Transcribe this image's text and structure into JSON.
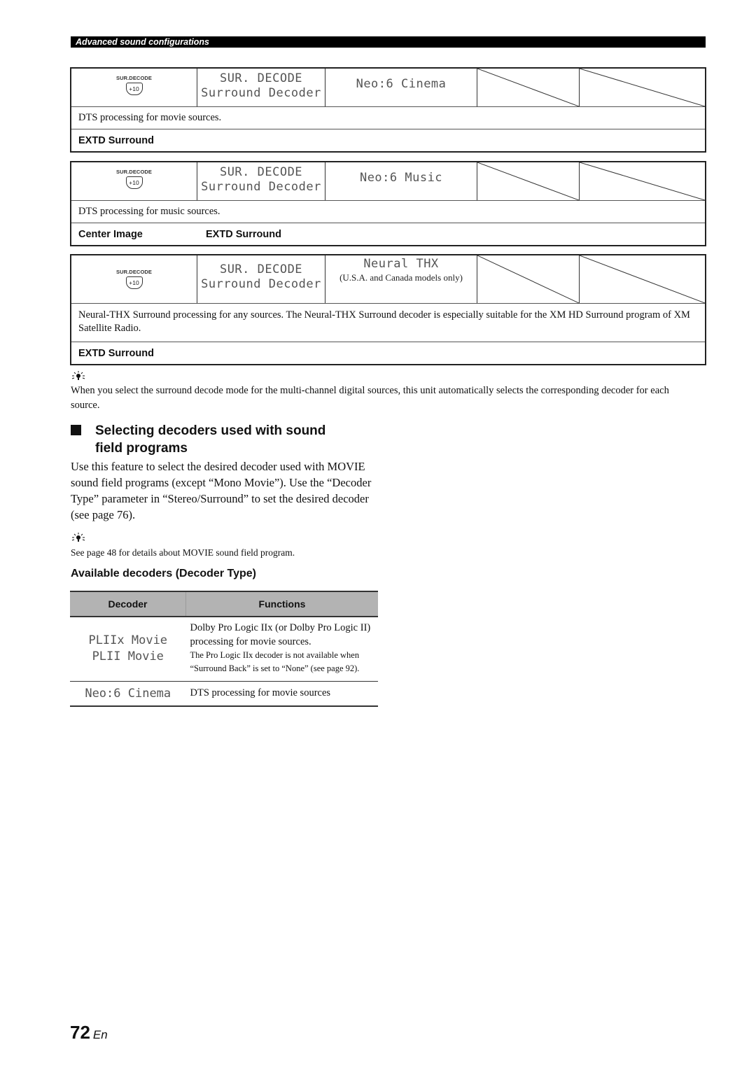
{
  "header": {
    "section": "Advanced sound configurations"
  },
  "modes": [
    {
      "button_label": "SUR.DECODE",
      "button_key": "+10",
      "display_line1": "SUR. DECODE",
      "display_line2": "Surround Decoder",
      "mode_name": "Neo:6 Cinema",
      "mode_note": "",
      "description": "DTS processing for movie sources.",
      "params": [
        "EXTD Surround"
      ]
    },
    {
      "button_label": "SUR.DECODE",
      "button_key": "+10",
      "display_line1": "SUR. DECODE",
      "display_line2": "Surround Decoder",
      "mode_name": "Neo:6 Music",
      "mode_note": "",
      "description": "DTS processing for music sources.",
      "params": [
        "Center Image",
        "EXTD Surround"
      ]
    },
    {
      "button_label": "SUR.DECODE",
      "button_key": "+10",
      "display_line1": "SUR. DECODE",
      "display_line2": "Surround Decoder",
      "mode_name": "Neural THX",
      "mode_note": "(U.S.A. and Canada models only)",
      "description": "Neural-THX Surround processing for any sources. The Neural-THX Surround decoder is especially suitable for the XM HD Surround program of XM Satellite Radio.",
      "params": [
        "EXTD Surround"
      ]
    }
  ],
  "tip1": {
    "icon": "tip-lightbulb-icon",
    "text": "When you select the surround decode mode for the multi-channel digital sources, this unit automatically selects the corresponding decoder for each source."
  },
  "section": {
    "title_line1": "Selecting decoders used with sound",
    "title_line2": "field programs",
    "body": "Use this feature to select the desired decoder used with MOVIE sound field programs (except “Mono Movie”). Use the “Decoder Type” parameter in “Stereo/Surround” to set the desired decoder (see page 76)."
  },
  "tip2": {
    "icon": "tip-lightbulb-icon",
    "text": "See page 48 for details about MOVIE sound field program."
  },
  "decoders": {
    "title": "Available decoders (Decoder Type)",
    "columns": [
      "Decoder",
      "Functions"
    ],
    "rows": [
      {
        "names": [
          "PLIIx Movie",
          "PLII Movie"
        ],
        "function_main": "Dolby Pro Logic IIx (or Dolby Pro Logic II) processing for movie sources.",
        "function_note": "The Pro Logic IIx decoder is not available when “Surround Back” is set to “None” (see page 92)."
      },
      {
        "names": [
          "Neo:6 Cinema"
        ],
        "function_main": "DTS processing for movie sources",
        "function_note": ""
      }
    ]
  },
  "footer": {
    "page_number": "72",
    "language": "En"
  }
}
